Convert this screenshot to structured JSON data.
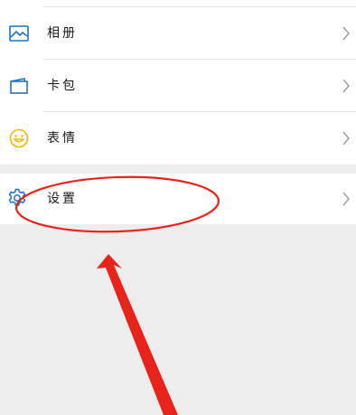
{
  "menu": {
    "items": [
      {
        "label": "相册",
        "icon": "album-icon"
      },
      {
        "label": "卡包",
        "icon": "card-wallet-icon"
      },
      {
        "label": "表情",
        "icon": "emoji-icon"
      }
    ],
    "settings": {
      "label": "设置",
      "icon": "gear-icon"
    }
  },
  "colors": {
    "accent": "#1a73c8",
    "emoji": "#f5b400",
    "annotation": "#e8231b",
    "background": "#ededed",
    "row": "#ffffff"
  }
}
